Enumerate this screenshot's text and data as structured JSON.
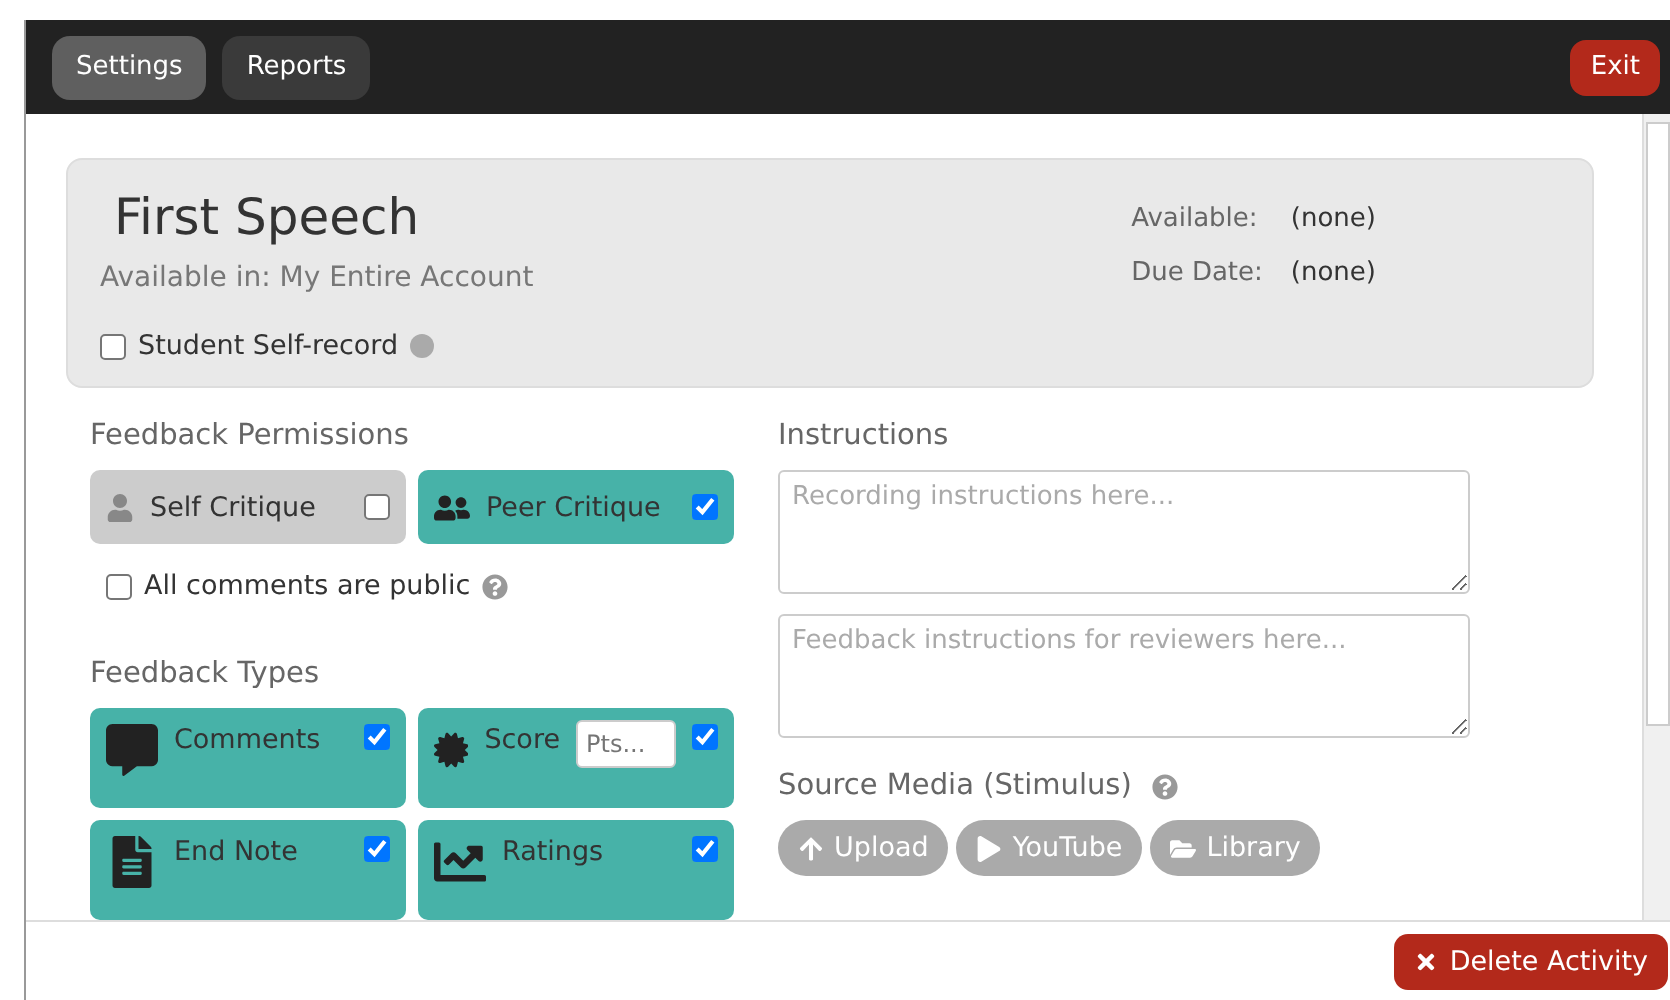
{
  "tabs": [
    {
      "label": "Settings",
      "selected": true
    },
    {
      "label": "Reports",
      "selected": false
    }
  ],
  "exit_button": "Exit",
  "header": {
    "title": "First Speech",
    "available_in": "Available in: My Entire Account",
    "self_record": {
      "label": "Student Self-record",
      "checked": false
    },
    "dates": [
      {
        "label": "Available:",
        "value": "(none)"
      },
      {
        "label": "Due Date:",
        "value": "(none)"
      }
    ]
  },
  "feedback_permissions": {
    "title": "Feedback Permissions",
    "items": [
      {
        "kind": "self",
        "label": "Self Critique",
        "checked": false
      },
      {
        "kind": "peer",
        "label": "Peer Critique",
        "checked": true
      }
    ],
    "public": {
      "label": "All comments are public",
      "checked": false
    }
  },
  "feedback_types": {
    "title": "Feedback Types",
    "items": [
      {
        "kind": "comments",
        "label": "Comments",
        "checked": true
      },
      {
        "kind": "score",
        "label": "Score",
        "checked": true,
        "placeholder": "Pts..."
      },
      {
        "kind": "endnote",
        "label": "End Note",
        "checked": true
      },
      {
        "kind": "ratings",
        "label": "Ratings",
        "checked": true
      }
    ]
  },
  "instructions": {
    "title": "Instructions",
    "fields": [
      {
        "placeholder": "Recording instructions here..."
      },
      {
        "placeholder": "Feedback instructions for reviewers here..."
      }
    ]
  },
  "source_media": {
    "title": "Source Media (Stimulus)",
    "buttons": [
      {
        "kind": "upload",
        "label": "Upload"
      },
      {
        "kind": "youtube",
        "label": "YouTube"
      },
      {
        "kind": "library",
        "label": "Library"
      }
    ]
  },
  "delete_button": "Delete Activity"
}
